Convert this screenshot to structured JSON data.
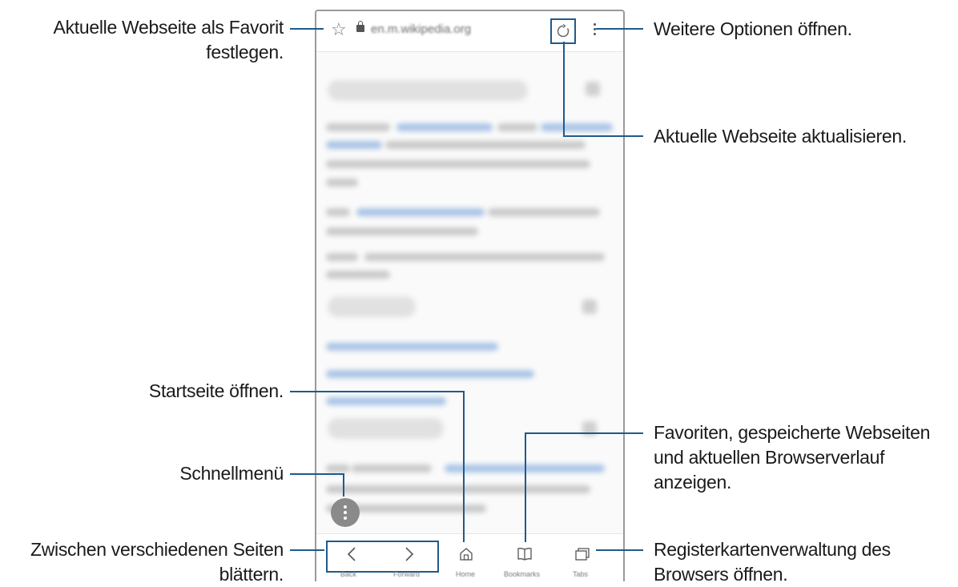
{
  "callouts": {
    "favorite": [
      "Aktuelle Webseite als Favorit",
      "festlegen."
    ],
    "more_options": "Weitere Optionen öffnen.",
    "refresh": "Aktuelle Webseite aktualisieren.",
    "home": "Startseite öffnen.",
    "quick_menu": "Schnellmenü",
    "navigate": [
      "Zwischen verschiedenen Seiten",
      "blättern."
    ],
    "bookmarks": [
      "Favoriten, gespeicherte Webseiten",
      "und aktuellen Browserverlauf",
      "anzeigen."
    ],
    "tabs": [
      "Registerkartenverwaltung des",
      "Browsers öffnen."
    ]
  },
  "browser": {
    "url": "en.m.wikipedia.org",
    "bottom_labels": {
      "back": "Back",
      "forward": "Forward",
      "home": "Home",
      "bookmarks": "Bookmarks",
      "tabs": "Tabs"
    }
  },
  "icons": {
    "star": "star-outline-icon",
    "lock": "lock-icon",
    "reload": "reload-icon",
    "more": "vertical-dots-icon",
    "quick": "quick-menu-icon",
    "back": "chevron-left-icon",
    "forward": "chevron-right-icon",
    "home": "home-icon",
    "bookmarks": "book-icon",
    "tabs": "tabs-icon"
  },
  "colors": {
    "callout_line": "#1f5a8c",
    "text": "#1a1a1a",
    "phone_border": "#9a9a9a"
  }
}
